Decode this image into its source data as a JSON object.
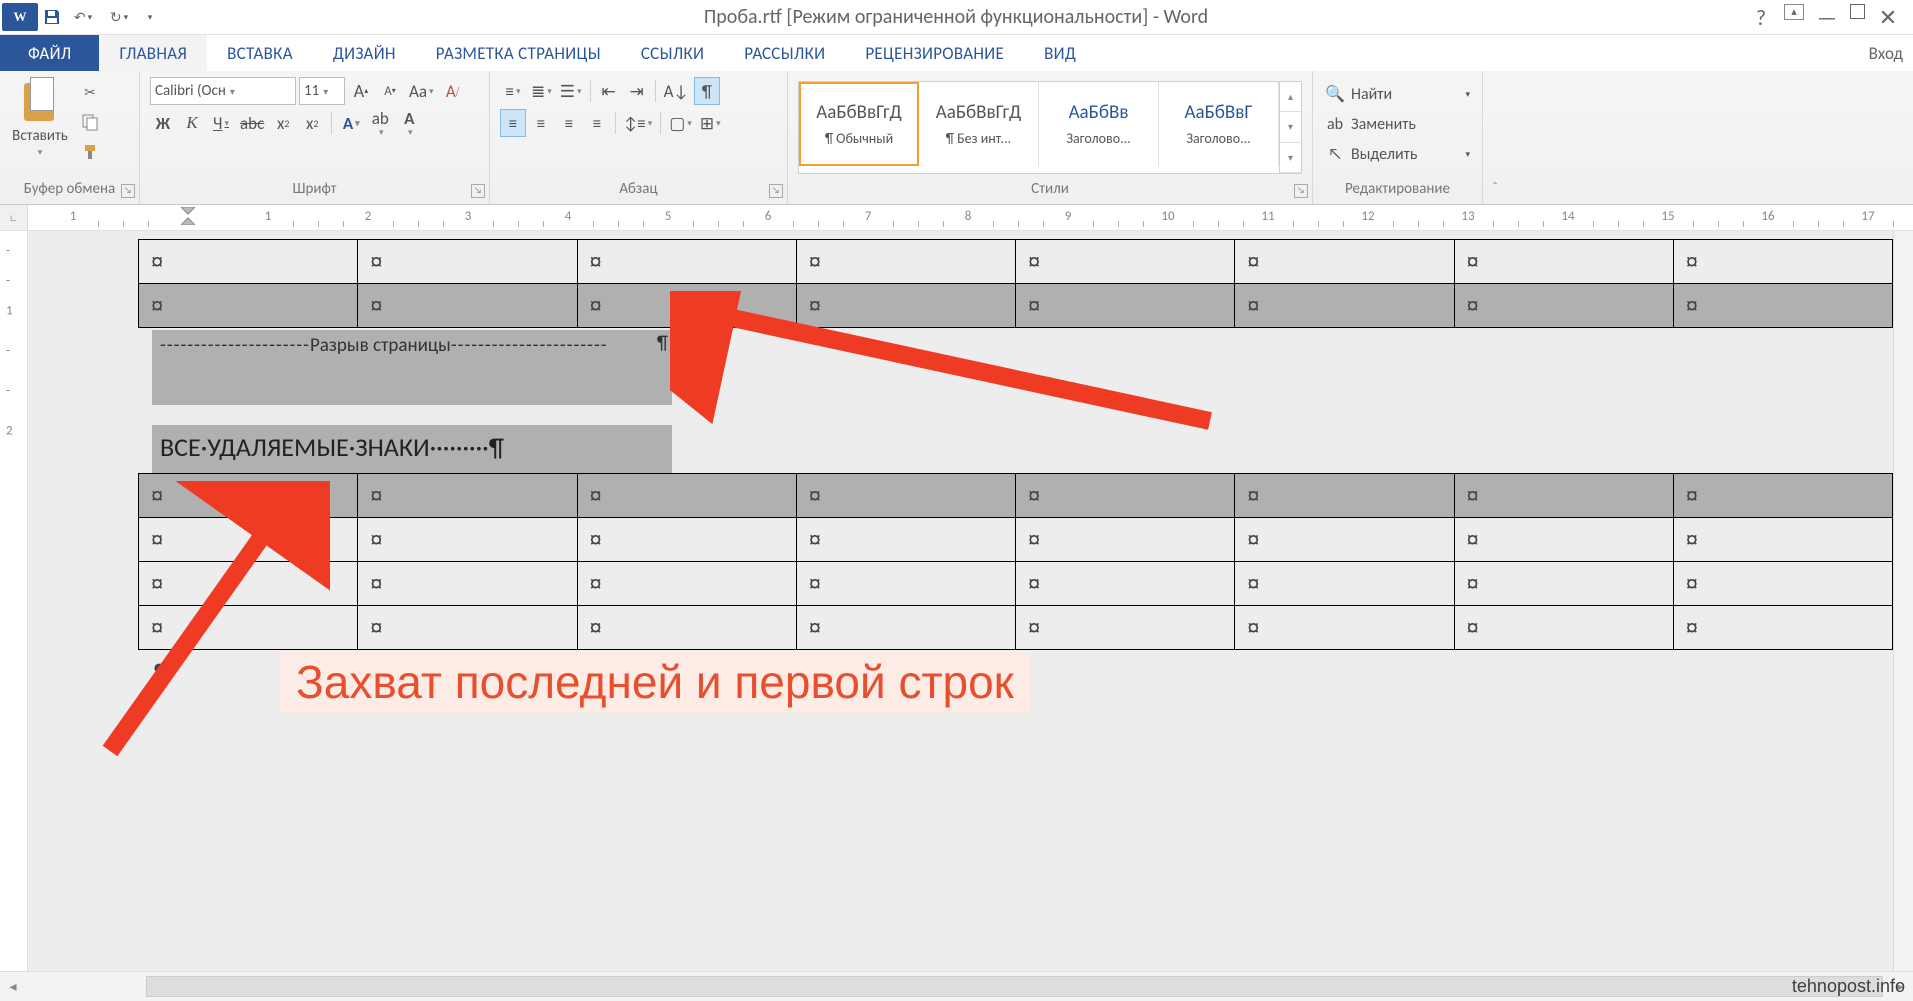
{
  "title": "Проба.rtf [Режим ограниченной функциональности] - Word",
  "login": "Вход",
  "tabs": {
    "file": "ФАЙЛ",
    "home": "ГЛАВНАЯ",
    "insert": "ВСТАВКА",
    "design": "ДИЗАЙН",
    "layout": "РАЗМЕТКА СТРАНИЦЫ",
    "refs": "ССЫЛКИ",
    "mailings": "РАССЫЛКИ",
    "review": "РЕЦЕНЗИРОВАНИЕ",
    "view": "ВИД"
  },
  "groups": {
    "clipboard": "Буфер обмена",
    "font": "Шрифт",
    "para": "Абзац",
    "styles": "Стили",
    "editing": "Редактирование"
  },
  "paste": "Вставить",
  "font": {
    "name": "Calibri (Осн",
    "size": "11"
  },
  "font_buttons": {
    "bold": "Ж",
    "italic": "К",
    "underline": "Ч",
    "strike": "abc",
    "sub": "x",
    "sup": "x",
    "grow": "A",
    "shrink": "A",
    "case": "Aa",
    "clear": "A"
  },
  "styles": [
    {
      "preview": "АаБбВвГгД",
      "name": "¶ Обычный",
      "sel": true,
      "blue": false
    },
    {
      "preview": "АаБбВвГгД",
      "name": "¶ Без инт...",
      "sel": false,
      "blue": false
    },
    {
      "preview": "АаБбВв",
      "name": "Заголово...",
      "sel": false,
      "blue": true
    },
    {
      "preview": "АаБбВвГ",
      "name": "Заголово...",
      "sel": false,
      "blue": true
    }
  ],
  "editing": {
    "find": "Найти",
    "replace": "Заменить",
    "select": "Выделить"
  },
  "ruler_numbers": [
    1,
    1,
    2,
    3,
    4,
    5,
    6,
    7,
    8,
    9,
    10,
    11,
    12,
    13,
    14,
    15,
    16,
    17
  ],
  "vruler_numbers": [
    "-",
    "-",
    "1",
    "-",
    "-",
    "2"
  ],
  "cell_mark": "¤",
  "page_break_label": "Разрыв страницы",
  "pilcrow": "¶",
  "heading_text": "BCE·УДАЛЯЕМЫЕ·ЗНАКИ·········¶",
  "annotation": "Захват последней и первой строк",
  "watermark": "tehnopost.info",
  "colors": {
    "highlight": "#ffff00",
    "font": "#d00000"
  }
}
